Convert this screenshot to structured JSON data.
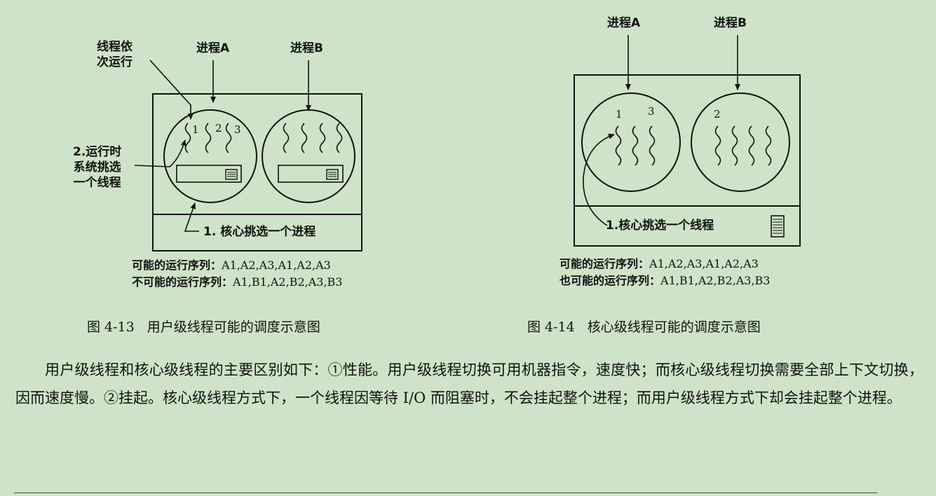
{
  "fig1": {
    "label_threads_in_turn": [
      "线程依",
      "次运行"
    ],
    "label_process_a": "进程A",
    "label_process_b": "进程B",
    "label_runtime_pick": [
      "2.运行时",
      "系统挑选",
      "一个线程"
    ],
    "thread_numbers": [
      "1",
      "2",
      "3"
    ],
    "kernel_pick": "1. 核心挑选一个进程",
    "seq_possible_label": "可能的运行序列：",
    "seq_possible_value": "A1,A2,A3,A1,A2,A3",
    "seq_impossible_label": "不可能的运行序列：",
    "seq_impossible_value": "A1,B1,A2,B2,A3,B3",
    "caption_number": "图 4-13",
    "caption_text": "用户级线程可能的调度示意图"
  },
  "fig2": {
    "label_process_a": "进程A",
    "label_process_b": "进程B",
    "thread_numbers": [
      "1",
      "3",
      "2"
    ],
    "kernel_pick": "1.核心挑选一个线程",
    "seq_possible_label": "可能的运行序列：",
    "seq_possible_value": "A1,A2,A3,A1,A2,A3",
    "seq_also_label": "也可能的运行序列：",
    "seq_also_value": "A1,B1,A2,B2,A3,B3",
    "caption_number": "图 4-14",
    "caption_text": "核心级线程可能的调度示意图"
  },
  "body": {
    "paragraph": "用户级线程和核心级线程的主要区别如下：①性能。用户级线程切换可用机器指令，速度快；而核心级线程切换需要全部上下文切换，因而速度慢。②挂起。核心级线程方式下，一个线程因等待 I/O 而阻塞时，不会挂起整个进程；而用户级线程方式下却会挂起整个进程。"
  }
}
